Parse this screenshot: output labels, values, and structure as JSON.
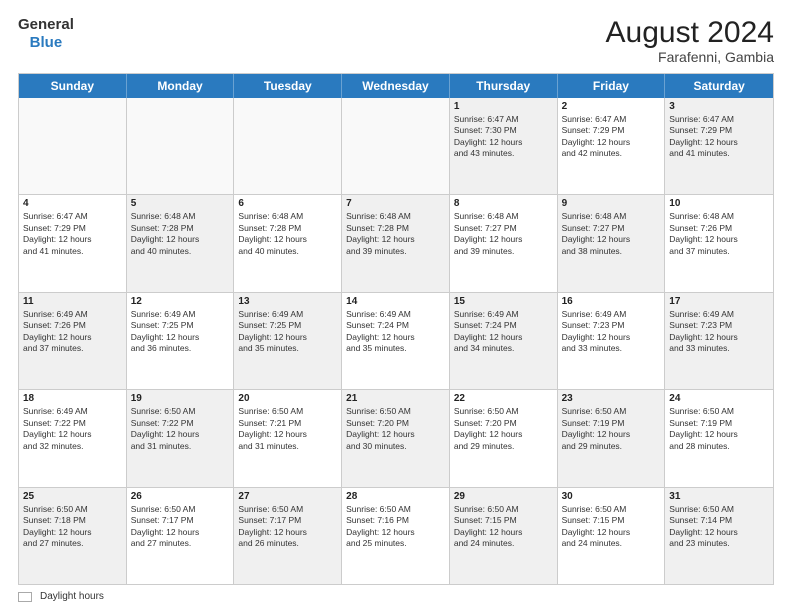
{
  "header": {
    "logo_general": "General",
    "logo_blue": "Blue",
    "month_year": "August 2024",
    "location": "Farafenni, Gambia"
  },
  "days_of_week": [
    "Sunday",
    "Monday",
    "Tuesday",
    "Wednesday",
    "Thursday",
    "Friday",
    "Saturday"
  ],
  "rows": [
    [
      {
        "day": "",
        "text": "",
        "empty": true
      },
      {
        "day": "",
        "text": "",
        "empty": true
      },
      {
        "day": "",
        "text": "",
        "empty": true
      },
      {
        "day": "",
        "text": "",
        "empty": true
      },
      {
        "day": "1",
        "text": "Sunrise: 6:47 AM\nSunset: 7:30 PM\nDaylight: 12 hours\nand 43 minutes.",
        "shaded": true
      },
      {
        "day": "2",
        "text": "Sunrise: 6:47 AM\nSunset: 7:29 PM\nDaylight: 12 hours\nand 42 minutes.",
        "shaded": false
      },
      {
        "day": "3",
        "text": "Sunrise: 6:47 AM\nSunset: 7:29 PM\nDaylight: 12 hours\nand 41 minutes.",
        "shaded": true
      }
    ],
    [
      {
        "day": "4",
        "text": "Sunrise: 6:47 AM\nSunset: 7:29 PM\nDaylight: 12 hours\nand 41 minutes.",
        "shaded": false
      },
      {
        "day": "5",
        "text": "Sunrise: 6:48 AM\nSunset: 7:28 PM\nDaylight: 12 hours\nand 40 minutes.",
        "shaded": true
      },
      {
        "day": "6",
        "text": "Sunrise: 6:48 AM\nSunset: 7:28 PM\nDaylight: 12 hours\nand 40 minutes.",
        "shaded": false
      },
      {
        "day": "7",
        "text": "Sunrise: 6:48 AM\nSunset: 7:28 PM\nDaylight: 12 hours\nand 39 minutes.",
        "shaded": true
      },
      {
        "day": "8",
        "text": "Sunrise: 6:48 AM\nSunset: 7:27 PM\nDaylight: 12 hours\nand 39 minutes.",
        "shaded": false
      },
      {
        "day": "9",
        "text": "Sunrise: 6:48 AM\nSunset: 7:27 PM\nDaylight: 12 hours\nand 38 minutes.",
        "shaded": true
      },
      {
        "day": "10",
        "text": "Sunrise: 6:48 AM\nSunset: 7:26 PM\nDaylight: 12 hours\nand 37 minutes.",
        "shaded": false
      }
    ],
    [
      {
        "day": "11",
        "text": "Sunrise: 6:49 AM\nSunset: 7:26 PM\nDaylight: 12 hours\nand 37 minutes.",
        "shaded": true
      },
      {
        "day": "12",
        "text": "Sunrise: 6:49 AM\nSunset: 7:25 PM\nDaylight: 12 hours\nand 36 minutes.",
        "shaded": false
      },
      {
        "day": "13",
        "text": "Sunrise: 6:49 AM\nSunset: 7:25 PM\nDaylight: 12 hours\nand 35 minutes.",
        "shaded": true
      },
      {
        "day": "14",
        "text": "Sunrise: 6:49 AM\nSunset: 7:24 PM\nDaylight: 12 hours\nand 35 minutes.",
        "shaded": false
      },
      {
        "day": "15",
        "text": "Sunrise: 6:49 AM\nSunset: 7:24 PM\nDaylight: 12 hours\nand 34 minutes.",
        "shaded": true
      },
      {
        "day": "16",
        "text": "Sunrise: 6:49 AM\nSunset: 7:23 PM\nDaylight: 12 hours\nand 33 minutes.",
        "shaded": false
      },
      {
        "day": "17",
        "text": "Sunrise: 6:49 AM\nSunset: 7:23 PM\nDaylight: 12 hours\nand 33 minutes.",
        "shaded": true
      }
    ],
    [
      {
        "day": "18",
        "text": "Sunrise: 6:49 AM\nSunset: 7:22 PM\nDaylight: 12 hours\nand 32 minutes.",
        "shaded": false
      },
      {
        "day": "19",
        "text": "Sunrise: 6:50 AM\nSunset: 7:22 PM\nDaylight: 12 hours\nand 31 minutes.",
        "shaded": true
      },
      {
        "day": "20",
        "text": "Sunrise: 6:50 AM\nSunset: 7:21 PM\nDaylight: 12 hours\nand 31 minutes.",
        "shaded": false
      },
      {
        "day": "21",
        "text": "Sunrise: 6:50 AM\nSunset: 7:20 PM\nDaylight: 12 hours\nand 30 minutes.",
        "shaded": true
      },
      {
        "day": "22",
        "text": "Sunrise: 6:50 AM\nSunset: 7:20 PM\nDaylight: 12 hours\nand 29 minutes.",
        "shaded": false
      },
      {
        "day": "23",
        "text": "Sunrise: 6:50 AM\nSunset: 7:19 PM\nDaylight: 12 hours\nand 29 minutes.",
        "shaded": true
      },
      {
        "day": "24",
        "text": "Sunrise: 6:50 AM\nSunset: 7:19 PM\nDaylight: 12 hours\nand 28 minutes.",
        "shaded": false
      }
    ],
    [
      {
        "day": "25",
        "text": "Sunrise: 6:50 AM\nSunset: 7:18 PM\nDaylight: 12 hours\nand 27 minutes.",
        "shaded": true
      },
      {
        "day": "26",
        "text": "Sunrise: 6:50 AM\nSunset: 7:17 PM\nDaylight: 12 hours\nand 27 minutes.",
        "shaded": false
      },
      {
        "day": "27",
        "text": "Sunrise: 6:50 AM\nSunset: 7:17 PM\nDaylight: 12 hours\nand 26 minutes.",
        "shaded": true
      },
      {
        "day": "28",
        "text": "Sunrise: 6:50 AM\nSunset: 7:16 PM\nDaylight: 12 hours\nand 25 minutes.",
        "shaded": false
      },
      {
        "day": "29",
        "text": "Sunrise: 6:50 AM\nSunset: 7:15 PM\nDaylight: 12 hours\nand 24 minutes.",
        "shaded": true
      },
      {
        "day": "30",
        "text": "Sunrise: 6:50 AM\nSunset: 7:15 PM\nDaylight: 12 hours\nand 24 minutes.",
        "shaded": false
      },
      {
        "day": "31",
        "text": "Sunrise: 6:50 AM\nSunset: 7:14 PM\nDaylight: 12 hours\nand 23 minutes.",
        "shaded": true
      }
    ]
  ],
  "footer": {
    "legend_label": "Daylight hours"
  }
}
